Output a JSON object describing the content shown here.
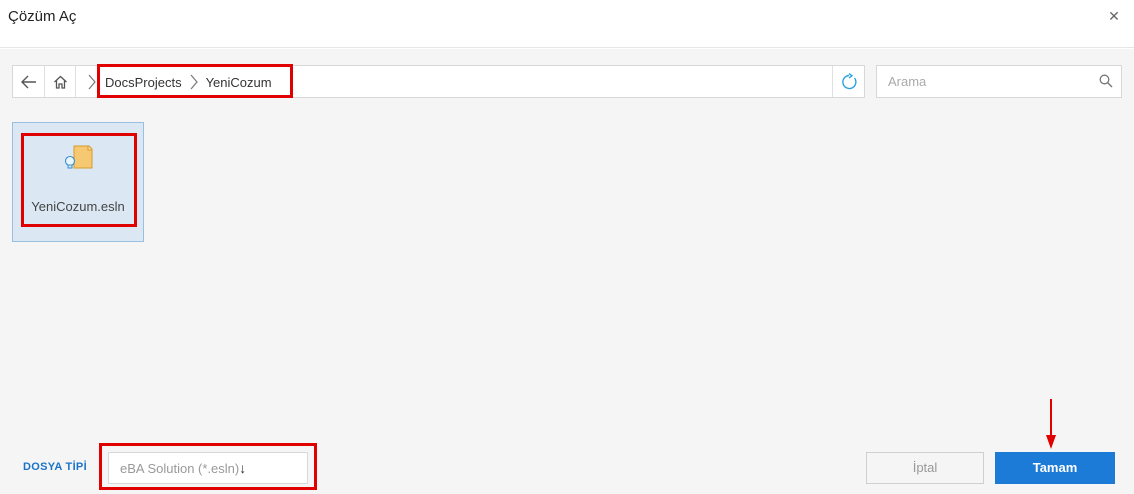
{
  "dialog": {
    "title": "Çözüm Aç",
    "close_icon": "close-icon"
  },
  "navigation": {
    "back_icon": "arrow-left-icon",
    "home_icon": "home-icon",
    "breadcrumb": [
      "DocsProjects",
      "YeniCozum"
    ],
    "refresh_icon": "refresh-icon"
  },
  "search": {
    "placeholder": "Arama",
    "value": "",
    "icon": "search-icon"
  },
  "files": [
    {
      "name": "YeniCozum.esln",
      "icon": "solution-file-icon",
      "selected": true
    }
  ],
  "footer": {
    "file_type_label": "DOSYA TİPİ",
    "file_type_value": "eBA Solution (*.esln)",
    "file_type_arrow": "↓",
    "cancel_label": "İptal",
    "ok_label": "Tamam"
  },
  "colors": {
    "accent": "#1b7bd6",
    "highlight": "#e00000",
    "selection": "#dbe8f4"
  }
}
